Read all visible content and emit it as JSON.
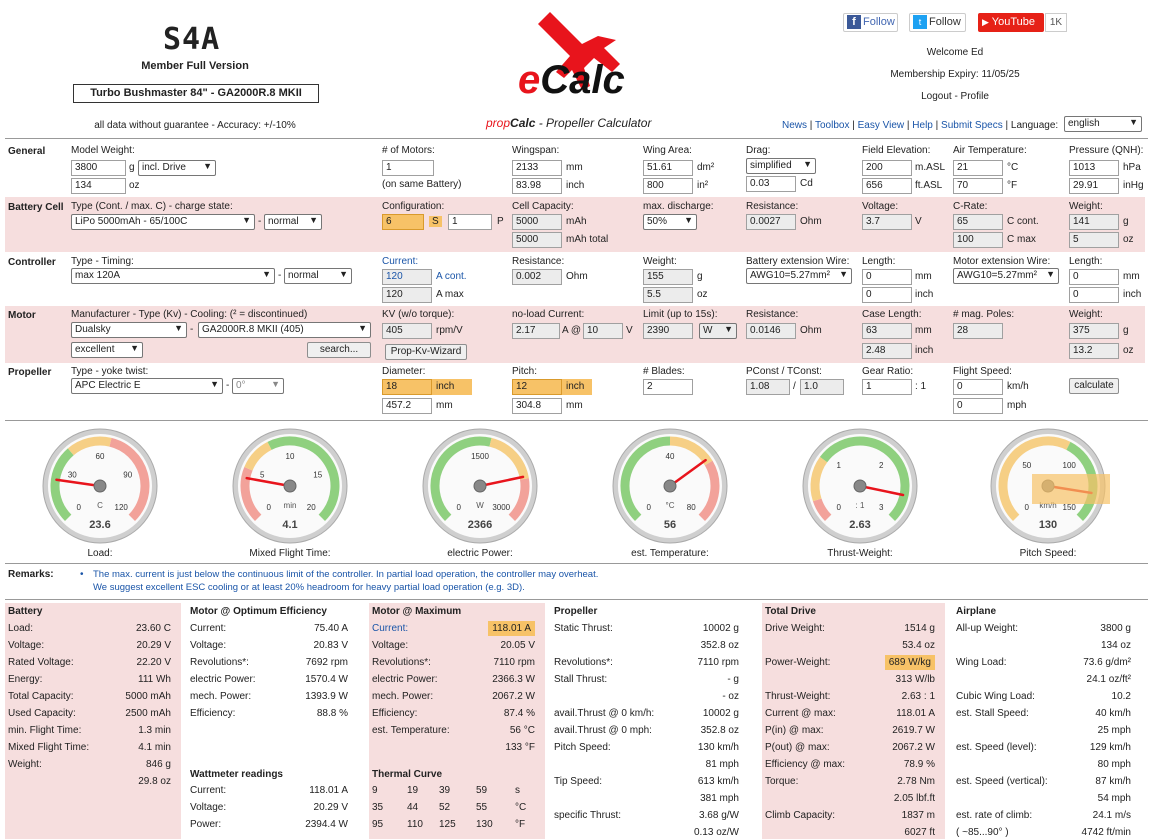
{
  "header": {
    "logo_text": "S4A",
    "member_version": "Member Full Version",
    "model_name": "Turbo Bushmaster 84\" - GA2000R.8 MKII",
    "disclaimer": "all data without guarantee - Accuracy: +/-10%",
    "app_logo": "eCalc",
    "subtitle_prefix": "prop",
    "subtitle_bold": "Calc",
    "subtitle_rest": " - Propeller Calculator",
    "follow_fb": "Follow",
    "follow_tw": "Follow",
    "youtube": "YouTube",
    "youtube_count": "1K",
    "welcome": "Welcome Ed",
    "membership": "Membership Expiry: 11/05/25",
    "logout": "Logout - Profile",
    "nav": [
      "News",
      "Toolbox",
      "Easy View",
      "Help",
      "Submit Specs"
    ],
    "language_label": "Language:",
    "language_value": "english"
  },
  "general": {
    "title": "General",
    "model_weight_label": "Model Weight:",
    "model_weight": "3800",
    "g": "g",
    "weight_mode": "incl. Drive",
    "model_weight_oz": "134",
    "oz": "oz",
    "motors_label": "# of Motors:",
    "motors": "1",
    "motors_note": "(on same Battery)",
    "wingspan_label": "Wingspan:",
    "wingspan_mm": "2133",
    "mm": "mm",
    "wingspan_in": "83.98",
    "inch": "inch",
    "wingarea_label": "Wing Area:",
    "wingarea_dm": "51.61",
    "dm2": "dm²",
    "wingarea_in": "800",
    "in2": "in²",
    "drag_label": "Drag:",
    "drag_mode": "simplified",
    "cd": "0.03",
    "cd_unit": "Cd",
    "field_label": "Field Elevation:",
    "field_m": "200",
    "masl": "m.ASL",
    "field_ft": "656",
    "ftasl": "ft.ASL",
    "air_label": "Air Temperature:",
    "air_c": "21",
    "degc": "°C",
    "air_f": "70",
    "degf": "°F",
    "pressure_label": "Pressure (QNH):",
    "pressure_hpa": "1013",
    "hpa": "hPa",
    "pressure_inhg": "29.91",
    "inhg": "inHg"
  },
  "battery": {
    "title": "Battery Cell",
    "type_label": "Type (Cont. / max. C) - charge state:",
    "type": "LiPo 5000mAh - 65/100C",
    "dash": "-",
    "state": "normal",
    "config_label": "Configuration:",
    "s": "6",
    "s_unit": "S",
    "p": "1",
    "p_unit": "P",
    "cap_label": "Cell Capacity:",
    "cap": "5000",
    "mah": "mAh",
    "cap_total": "5000",
    "mah_total": "mAh total",
    "maxdis_label": "max. discharge:",
    "maxdis": "50%",
    "res_label": "Resistance:",
    "res": "0.0027",
    "ohm": "Ohm",
    "volt_label": "Voltage:",
    "volt": "3.7",
    "v": "V",
    "crate_label": "C-Rate:",
    "c_cont": "65",
    "c_cont_unit": "C cont.",
    "c_max": "100",
    "c_max_unit": "C max",
    "weight_label": "Weight:",
    "weight_g": "141",
    "weight_oz": "5"
  },
  "controller": {
    "title": "Controller",
    "type_label": "Type - Timing:",
    "type": "max 120A",
    "timing": "normal",
    "current_label": "Current:",
    "cont": "120",
    "cont_unit": "A cont.",
    "max": "120",
    "max_unit": "A max",
    "res_label": "Resistance:",
    "res": "0.002",
    "weight_label": "Weight:",
    "weight_g": "155",
    "weight_oz": "5.5",
    "ext_label": "Battery extension Wire:",
    "ext": "AWG10=5.27mm²",
    "len_label": "Length:",
    "len_mm": "0",
    "len_in": "0",
    "mext_label": "Motor extension Wire:",
    "mext": "AWG10=5.27mm²",
    "mlen_label": "Length:",
    "mlen_mm": "0",
    "mlen_in": "0"
  },
  "motor": {
    "title": "Motor",
    "mfr_label": "Manufacturer - Type (Kv) - Cooling:  (² = discontinued)",
    "mfr": "Dualsky",
    "type": "GA2000R.8 MKII (405)",
    "cooling": "excellent",
    "search": "search...",
    "kv_label": "KV (w/o torque):",
    "kv": "405",
    "rpmv": "rpm/V",
    "wizard": "Prop-Kv-Wizard",
    "nl_label": "no-load Current:",
    "nl_a": "2.17",
    "at": "A @",
    "nl_v": "10",
    "limit_label": "Limit (up to 15s):",
    "limit": "2390",
    "limit_unit": "W",
    "res_label": "Resistance:",
    "res": "0.0146",
    "case_label": "Case Length:",
    "case_mm": "63",
    "case_in": "2.48",
    "poles_label": "# mag. Poles:",
    "poles": "28",
    "weight_label": "Weight:",
    "weight_g": "375",
    "weight_oz": "13.2"
  },
  "propeller": {
    "title": "Propeller",
    "type_label": "Type - yoke twist:",
    "type": "APC Electric E",
    "twist": "0°",
    "dia_label": "Diameter:",
    "dia_in": "18",
    "dia_mm": "457.2",
    "pitch_label": "Pitch:",
    "pitch_in": "12",
    "pitch_mm": "304.8",
    "blades_label": "# Blades:",
    "blades": "2",
    "pconst_label": "PConst / TConst:",
    "pconst": "1.08",
    "tconst": "1.0",
    "gear_label": "Gear Ratio:",
    "gear": "1",
    "gear_unit": ": 1",
    "speed_label": "Flight Speed:",
    "speed_kmh": "0",
    "kmh": "km/h",
    "speed_mph": "0",
    "mph": "mph",
    "calculate": "calculate"
  },
  "gauges": [
    {
      "caption": "Load:",
      "value": "23.6",
      "unit": "C",
      "ticks": [
        "0",
        "30",
        "60",
        "90",
        "120"
      ],
      "level": 0.197
    },
    {
      "caption": "Mixed Flight Time:",
      "value": "4.1",
      "unit": "min",
      "ticks": [
        "0",
        "5",
        "10",
        "15",
        "20"
      ],
      "level": 0.205
    },
    {
      "caption": "electric Power:",
      "value": "2366",
      "unit": "W",
      "ticks": [
        "0",
        "1500",
        "3000"
      ],
      "level": 0.789
    },
    {
      "caption": "est. Temperature:",
      "value": "56",
      "unit": "°C",
      "ticks": [
        "0",
        "40",
        "80"
      ],
      "level": 0.7
    },
    {
      "caption": "Thrust-Weight:",
      "value": "2.63",
      "unit": ": 1",
      "ticks": [
        "0",
        "1",
        "2",
        "3"
      ],
      "level": 0.877
    },
    {
      "caption": "Pitch Speed:",
      "value": "130",
      "unit": "km/h",
      "ticks": [
        "0",
        "50",
        "100",
        "150"
      ],
      "level": 0.867
    }
  ],
  "remarks": {
    "label": "Remarks:",
    "bullet": "•",
    "line1": "The max. current is just below the continuous limit of the controller. In partial load operation, the controller may overheat.",
    "line2": "We suggest excellent ESC cooling or at least 20% headroom for heavy partial load operation (e.g. 3D)."
  },
  "results": {
    "battery": {
      "title": "Battery",
      "rows": [
        [
          "Load:",
          "23.60 C"
        ],
        [
          "Voltage:",
          "20.29 V"
        ],
        [
          "Rated Voltage:",
          "22.20 V"
        ],
        [
          "Energy:",
          "111 Wh"
        ],
        [
          "Total Capacity:",
          "5000 mAh"
        ],
        [
          "Used Capacity:",
          "2500 mAh"
        ],
        [
          "min. Flight Time:",
          "1.3 min"
        ],
        [
          "Mixed Flight Time:",
          "4.1 min"
        ],
        [
          "Weight:",
          "846 g"
        ],
        [
          "",
          "29.8 oz"
        ]
      ]
    },
    "opt": {
      "title": "Motor @ Optimum Efficiency",
      "rows": [
        [
          "Current:",
          "75.40 A"
        ],
        [
          "Voltage:",
          "20.83 V"
        ],
        [
          "Revolutions*:",
          "7692 rpm"
        ],
        [
          "electric Power:",
          "1570.4 W"
        ],
        [
          "mech. Power:",
          "1393.9 W"
        ],
        [
          "Efficiency:",
          "88.8 %"
        ]
      ],
      "watt_title": "Wattmeter readings",
      "watt_rows": [
        [
          "Current:",
          "118.01 A"
        ],
        [
          "Voltage:",
          "20.29 V"
        ],
        [
          "Power:",
          "2394.4 W"
        ]
      ]
    },
    "max": {
      "title": "Motor @ Maximum",
      "rows": [
        [
          "Current:",
          "118.01 A"
        ],
        [
          "Voltage:",
          "20.05 V"
        ],
        [
          "Revolutions*:",
          "7110 rpm"
        ],
        [
          "electric Power:",
          "2366.3 W"
        ],
        [
          "mech. Power:",
          "2067.2 W"
        ],
        [
          "Efficiency:",
          "87.4 %"
        ],
        [
          "est. Temperature:",
          "56 °C"
        ],
        [
          "",
          "133 °F"
        ]
      ],
      "thermal_title": "Thermal Curve",
      "thermal": [
        [
          "9",
          "19",
          "39",
          "59",
          "s"
        ],
        [
          "35",
          "44",
          "52",
          "55",
          "°C"
        ],
        [
          "95",
          "110",
          "125",
          "130",
          "°F"
        ]
      ]
    },
    "prop": {
      "title": "Propeller",
      "rows": [
        [
          "Static Thrust:",
          "10002 g"
        ],
        [
          "",
          "352.8 oz"
        ],
        [
          "Revolutions*:",
          "7110 rpm"
        ],
        [
          "Stall Thrust:",
          "- g"
        ],
        [
          "",
          "- oz"
        ],
        [
          "avail.Thrust @ 0 km/h:",
          "10002 g"
        ],
        [
          "avail.Thrust @ 0 mph:",
          "352.8 oz"
        ],
        [
          "Pitch Speed:",
          "130 km/h"
        ],
        [
          "",
          "81 mph"
        ],
        [
          "Tip Speed:",
          "613 km/h"
        ],
        [
          "",
          "381 mph"
        ],
        [
          "specific Thrust:",
          "3.68 g/W"
        ],
        [
          "",
          "0.13 oz/W"
        ]
      ]
    },
    "drive": {
      "title": "Total Drive",
      "rows": [
        [
          "Drive Weight:",
          "1514 g"
        ],
        [
          "",
          "53.4 oz"
        ],
        [
          "Power-Weight:",
          "689 W/kg"
        ],
        [
          "",
          "313 W/lb"
        ],
        [
          "Thrust-Weight:",
          "2.63 : 1"
        ],
        [
          "Current @ max:",
          "118.01 A"
        ],
        [
          "P(in) @ max:",
          "2619.7 W"
        ],
        [
          "P(out) @ max:",
          "2067.2 W"
        ],
        [
          "Efficiency @ max:",
          "78.9 %"
        ],
        [
          "Torque:",
          "2.78 Nm"
        ],
        [
          "",
          "2.05 lbf.ft"
        ],
        [
          "Climb Capacity:",
          "1837 m"
        ],
        [
          "",
          "6027 ft"
        ]
      ]
    },
    "plane": {
      "title": "Airplane",
      "rows": [
        [
          "All-up Weight:",
          "3800 g"
        ],
        [
          "",
          "134 oz"
        ],
        [
          "Wing Load:",
          "73.6 g/dm²"
        ],
        [
          "",
          "24.1 oz/ft²"
        ],
        [
          "Cubic Wing Load:",
          "10.2"
        ],
        [
          "est. Stall Speed:",
          "40 km/h"
        ],
        [
          "",
          "25 mph"
        ],
        [
          "est. Speed (level):",
          "129 km/h"
        ],
        [
          "",
          "80 mph"
        ],
        [
          "est. Speed (vertical):",
          "87 km/h"
        ],
        [
          "",
          "54 mph"
        ],
        [
          "est. rate of climb:",
          "24.1 m/s"
        ],
        [
          "( ~85...90° )",
          "4742 ft/min"
        ]
      ]
    }
  },
  "colors": {
    "pink": "#f6dede",
    "highlight": "#f7c267",
    "link": "#1a55a8",
    "red": "#e8141c"
  }
}
